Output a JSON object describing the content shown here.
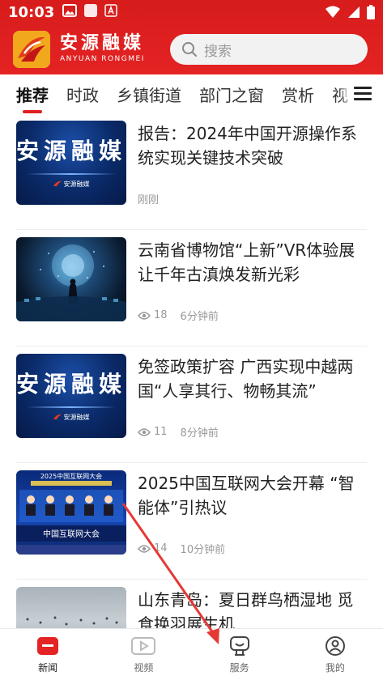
{
  "status_bar": {
    "time": "10:03"
  },
  "header": {
    "brand_cn": "安源融媒",
    "brand_en": "ANYUAN RONGMEI",
    "search_placeholder": "搜索"
  },
  "tabs": [
    {
      "label": "推荐"
    },
    {
      "label": "时政"
    },
    {
      "label": "乡镇街道"
    },
    {
      "label": "部门之窗"
    },
    {
      "label": "赏析"
    },
    {
      "label": "视"
    }
  ],
  "news": [
    {
      "title": "报告：2024年中国开源操作系统实现关键技术突破",
      "views": "",
      "time": "刚刚",
      "thumb_text": "安源融媒",
      "thumb_text_small": "安源融媒"
    },
    {
      "title": "云南省博物馆“上新”VR体验展 让千年古滇焕发新光彩",
      "views": "18",
      "time": "6分钟前"
    },
    {
      "title": "免签政策扩容 广西实现中越两国“人享其行、物畅其流”",
      "views": "11",
      "time": "8分钟前",
      "thumb_text": "安源融媒",
      "thumb_text_small": "安源融媒"
    },
    {
      "title": "2025中国互联网大会开幕 “智能体”引热议",
      "views": "14",
      "time": "10分钟前",
      "thumb_text": "2025中国互联网大会",
      "thumb_text_small": "中国互联网大会"
    },
    {
      "title": "山东青岛：夏日群鸟栖湿地 觅食换羽展生机",
      "views": "",
      "time": ""
    }
  ],
  "bottom_nav": [
    {
      "label": "新闻",
      "icon": "news-icon"
    },
    {
      "label": "视频",
      "icon": "video-icon"
    },
    {
      "label": "服务",
      "icon": "service-icon"
    },
    {
      "label": "我的",
      "icon": "profile-icon"
    }
  ],
  "colors": {
    "brand_red": "#e42323",
    "annotation_arrow": "#e53935"
  }
}
